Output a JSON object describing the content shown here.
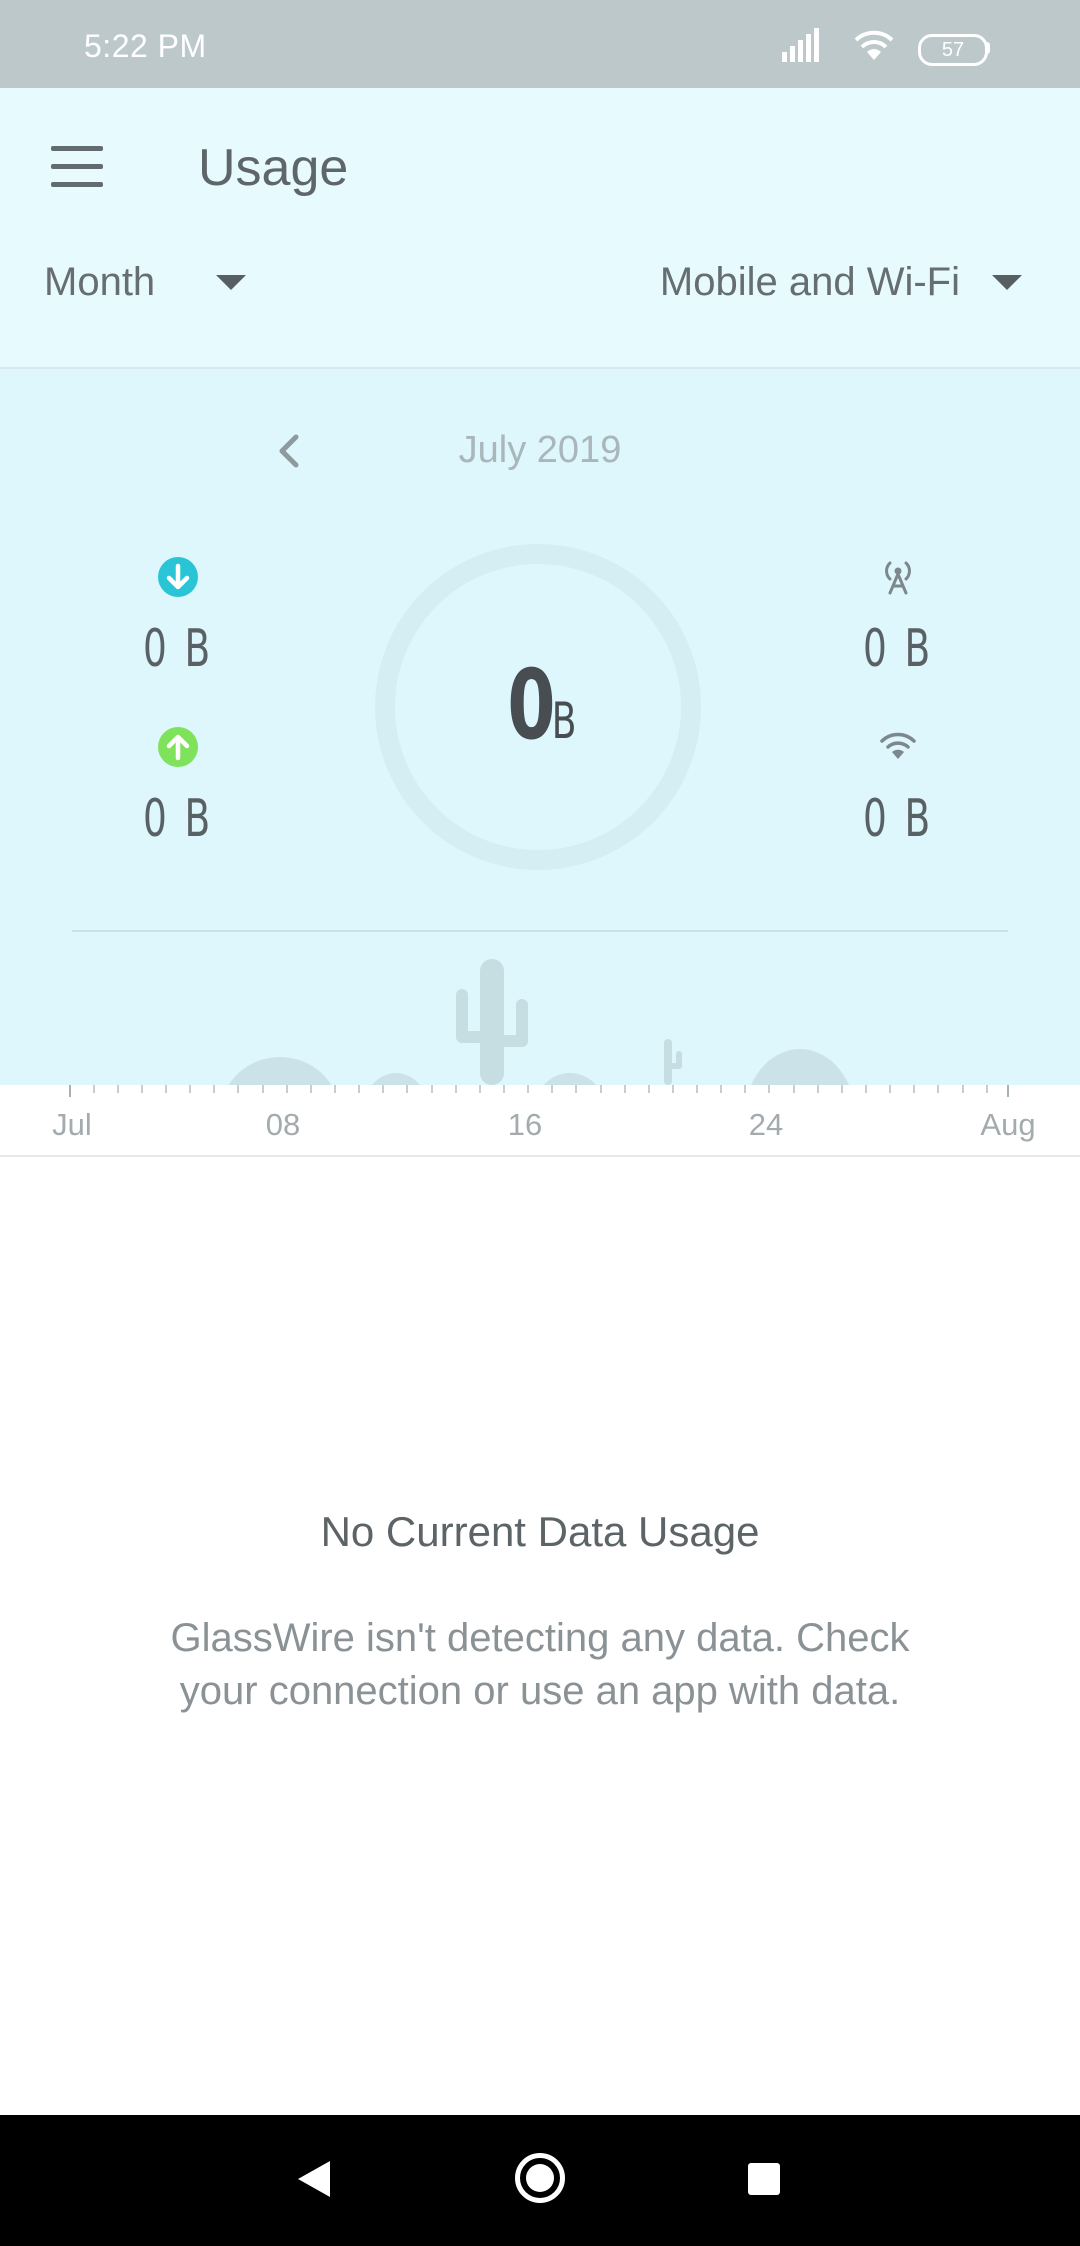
{
  "status_bar": {
    "time": "5:22 PM",
    "battery_level": "57",
    "icons": [
      "signal-icon",
      "wifi-icon",
      "battery-icon"
    ]
  },
  "app_bar": {
    "title": "Usage",
    "period_selector": "Month",
    "network_selector": "Mobile and Wi-Fi"
  },
  "summary": {
    "month": "July 2019",
    "download": "0 B",
    "upload": "0 B",
    "total_value": "0",
    "total_unit": "B",
    "mobile": "0 B",
    "wifi": "0 B",
    "colors": {
      "download": "#29c5d6",
      "upload": "#7ee25a",
      "panel_background": "#ddf7fc"
    }
  },
  "timeline": {
    "labels": [
      "Jul",
      "08",
      "16",
      "24",
      "Aug"
    ]
  },
  "empty_state": {
    "title": "No Current Data Usage",
    "message": "GlassWire isn't detecting any data. Check your connection or use an app with data."
  }
}
